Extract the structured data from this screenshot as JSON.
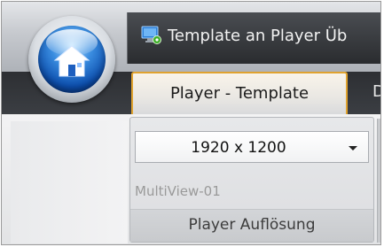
{
  "window": {
    "title": "Template an Player Üb"
  },
  "app_button": {
    "icon": "home-icon"
  },
  "ribbon": {
    "tabs": [
      {
        "label": "Player - Template",
        "active": true
      },
      {
        "label": "D",
        "active": false
      }
    ],
    "group": {
      "resolution_dropdown": {
        "selected": "1920 x 1200"
      },
      "multiview_text": "MultiView-01",
      "label": "Player Auflösung"
    }
  },
  "colors": {
    "active_tab_border": "#e0a32f",
    "titlebar_dark": "#2a2c2f",
    "orb_blue": "#0d4fae"
  }
}
